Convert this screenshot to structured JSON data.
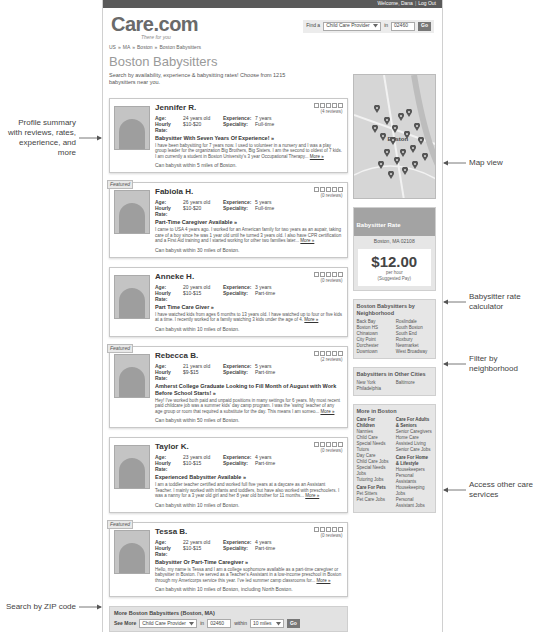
{
  "top_bar": {
    "welcome": "Welcome, Dana",
    "separator": "|",
    "logout": "Log Out"
  },
  "logo": {
    "text": "Care.com",
    "tagline": "There for you"
  },
  "header_search": {
    "label": "Find a",
    "type": "Child Care Provider",
    "in": "in",
    "zip": "02460",
    "button": "Go"
  },
  "breadcrumb": {
    "items": [
      "US",
      "MA",
      "Boston",
      "Boston Babysitters"
    ],
    "separator": "»"
  },
  "title": "Boston Babysitters",
  "subtitle": "Search by availability, experience & babysitting rates! Choose from 1215 babysitters near you.",
  "stat_labels": {
    "age": "Age:",
    "experience": "Experience:",
    "rate": "Hourly Rate:",
    "speciality": "Speciality:"
  },
  "featured_label": "Featured",
  "more_link": "More »",
  "profiles": [
    {
      "name": "Jennifer R.",
      "featured": false,
      "age": "24 years old",
      "experience": "7 years",
      "rate": "$10-$20",
      "speciality": "Full-time",
      "stars": 0,
      "reviews": "(4 reviews)",
      "headline": "Babysitter With Seven Years Of Experience! »",
      "description": "I have been babysitting for 7 years now. I used to volunteer in a nursery and I was a play group leader for the organization Big Brothers, Big Sisters. I am the second to oldest of 7 kids. I am currently a student in Boston University's 3 year Occupational Therapy...",
      "distance": "Can babysit within 5 miles of Boston."
    },
    {
      "name": "Fabiola H.",
      "featured": true,
      "age": "26 years old",
      "experience": "5 years",
      "rate": "$10-$20",
      "speciality": "Full-time",
      "stars": 0,
      "reviews": "(0 reviews)",
      "headline": "Part-Time Caregiver Available »",
      "description": "I came to USA 4 years ago. I worked for an American family for two years as an aupair, taking care of a boy since he was 1 year old until he turned 3 years old. I also have CPR certification and a First Aid training and I started working for other two families later...",
      "distance": "Can babysit within 30 miles of Boston."
    },
    {
      "name": "Anneke H.",
      "featured": false,
      "age": "20 years old",
      "experience": "3 years",
      "rate": "$10-$15",
      "speciality": "Part-time",
      "stars": 0,
      "reviews": "(0 reviews)",
      "headline": "Part Time Care Giver »",
      "description": "I have watched kids from ages 6 months to 13 years old. I have watched up to four or five kids at a time. I recently worked for a family watching 3 kids under the age of 4.",
      "distance": "Can babysit within 10 miles of Boston."
    },
    {
      "name": "Rebecca B.",
      "featured": true,
      "age": "21 years old",
      "experience": "5 years",
      "rate": "$9-$15",
      "speciality": "Part-time",
      "stars": 0,
      "reviews": "(2 reviews)",
      "headline": "Amherst College Graduate Looking to Fill Month of August with Work Before School Starts! »",
      "description": "Hey! I've worked both paid and unpaid positions in many settings for 6 years. My most recent paid childcare job was a summer kids' day camp program. I was the 'swing' teacher of any age group or room that required a substitute for the day. This means I am someo...",
      "distance": "Can babysit within 50 miles of Boston."
    },
    {
      "name": "Taylor K.",
      "featured": false,
      "age": "23 years old",
      "experience": "4 years",
      "rate": "$10-$15",
      "speciality": "Part-time",
      "stars": 0,
      "reviews": "(0 reviews)",
      "headline": "Experienced Babysitter Available »",
      "description": "I am a toddler teacher certified and worked full five years at a daycare as an Assistant Teacher. I mainly worked with infants and toddlers, but have also worked with preschoolers. I was a nanny for a 3 year old girl and her 8 year old brother for 11 months...",
      "distance": "Can babysit within 10 miles of Boston."
    },
    {
      "name": "Tessa B.",
      "featured": true,
      "age": "22 years old",
      "experience": "4 years",
      "rate": "$10-$15",
      "speciality": "Part-time",
      "stars": 0,
      "reviews": "(0 reviews)",
      "headline": "Babysitter Or Part-Time Caregiver »",
      "description": "Hello, my name is Tessa and I am a college sophomore available as a part-time caregiver or babysitter in Boston. I've served as a Teacher's Assistant in a low-income preschool in Boston through my Americorps service this year. I've led summer camp classrooms for...",
      "distance": "Can babysit within 10 miles of Boston, including North Boston."
    }
  ],
  "more_search": {
    "title": "More Boston Babysitters (Boston, MA)",
    "label": "See More",
    "type": "Child Care Provider",
    "in": "in",
    "zip": "02460",
    "within": "within",
    "radius": "10 miles",
    "button": "Go"
  },
  "map": {
    "label": "Boston"
  },
  "rate": {
    "title": "Babysitter Rate",
    "location": "Boston, MA 02108",
    "amount": "$12.00",
    "unit": "per hour",
    "note": "(Suggested Pay)"
  },
  "neighborhoods": {
    "title": "Boston Babysitters by Neighborhood",
    "columns": [
      [
        "Back Bay",
        "Boston HS",
        "Chinatown",
        "City Point",
        "Dorchester",
        "Downtown"
      ],
      [
        "Roslindale",
        "South Boston",
        "South End",
        "Roxbury",
        "Newmarket",
        "West Broadway"
      ]
    ]
  },
  "other_cities": {
    "title": "Babysitters in Other Cities",
    "columns": [
      [
        "New York",
        "Philadelphia"
      ],
      [
        "Baltimore"
      ]
    ]
  },
  "more_in": {
    "title": "More in Boston",
    "columns": [
      [
        {
          "title": "Care For Children",
          "items": [
            "Nannies",
            "Child Care",
            "Special Needs",
            "Tutors",
            "Day Care",
            "Child Care Jobs",
            "Special Needs Jobs",
            "Tutoring Jobs"
          ]
        },
        {
          "title": "Care For Pets",
          "items": [
            "Pet Sitters",
            "Pet Care Jobs"
          ]
        }
      ],
      [
        {
          "title": "Care For Adults & Seniors",
          "items": [
            "Senior Caregivers",
            "Home Care",
            "Assisted Living",
            "Senior Care Jobs"
          ]
        },
        {
          "title": "Care For Home & Lifestyle",
          "items": [
            "Housekeepers",
            "Personal Assistants",
            "Housekeeping Jobs",
            "Personal Assistant Jobs"
          ]
        }
      ]
    ]
  },
  "annotations": {
    "profile": "Profile summary with reviews, rates, experience, and more",
    "zip": "Search by ZIP code",
    "map": "Map view",
    "rate": "Babysitter rate calculator",
    "neighborhood": "Filter by neighborhood",
    "services": "Access other care services"
  }
}
